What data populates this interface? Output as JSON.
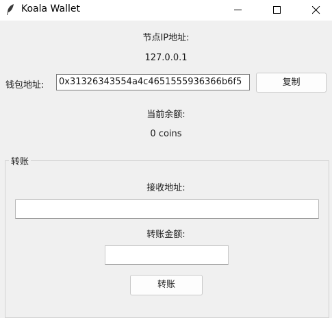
{
  "window": {
    "title": "Koala Wallet",
    "icon": "feather-icon",
    "controls": [
      "minimize-icon",
      "maximize-icon",
      "close-icon"
    ]
  },
  "node": {
    "label": "节点IP地址:",
    "ip": "127.0.0.1"
  },
  "wallet": {
    "label": "钱包地址:",
    "address": "0x31326343554a4c4651555936366b6f5",
    "copy_label": "复制"
  },
  "balance": {
    "label": "当前余额:",
    "value": "0 coins"
  },
  "transfer": {
    "group_title": "转账",
    "recipient_label": "接收地址:",
    "recipient_value": "",
    "amount_label": "转账金额:",
    "amount_value": "",
    "submit_label": "转账"
  }
}
